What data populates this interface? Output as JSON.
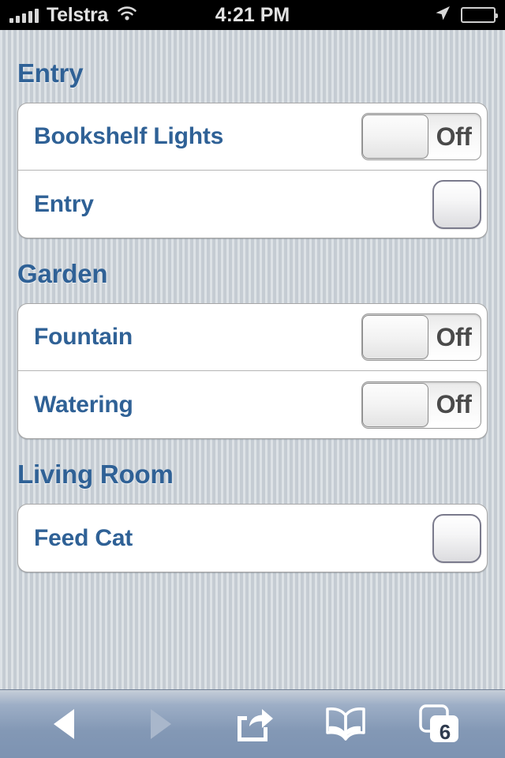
{
  "status_bar": {
    "carrier": "Telstra",
    "time": "4:21 PM",
    "signal_icon": "signal-bars-icon",
    "wifi_icon": "wifi-icon",
    "location_icon": "location-arrow-icon",
    "battery_icon": "battery-icon"
  },
  "sections": [
    {
      "title": "Entry",
      "rows": [
        {
          "label": "Bookshelf Lights",
          "control": "switch",
          "state": "Off"
        },
        {
          "label": "Entry",
          "control": "button",
          "state": ""
        }
      ]
    },
    {
      "title": "Garden",
      "rows": [
        {
          "label": "Fountain",
          "control": "switch",
          "state": "Off"
        },
        {
          "label": "Watering",
          "control": "switch",
          "state": "Off"
        }
      ]
    },
    {
      "title": "Living Room",
      "rows": [
        {
          "label": "Feed Cat",
          "control": "button",
          "state": ""
        }
      ]
    }
  ],
  "toolbar": {
    "back_icon": "back-arrow-icon",
    "forward_icon": "forward-arrow-icon",
    "share_icon": "share-icon",
    "bookmarks_icon": "bookmarks-book-icon",
    "tabs_icon": "tabs-icon",
    "tabs_count": "6"
  },
  "colors": {
    "accent_blue": "#2f6196",
    "background": "#c7ced6",
    "card": "#ffffff",
    "toolbar": "#8398b5",
    "switch_label": "#4a4a4a"
  }
}
